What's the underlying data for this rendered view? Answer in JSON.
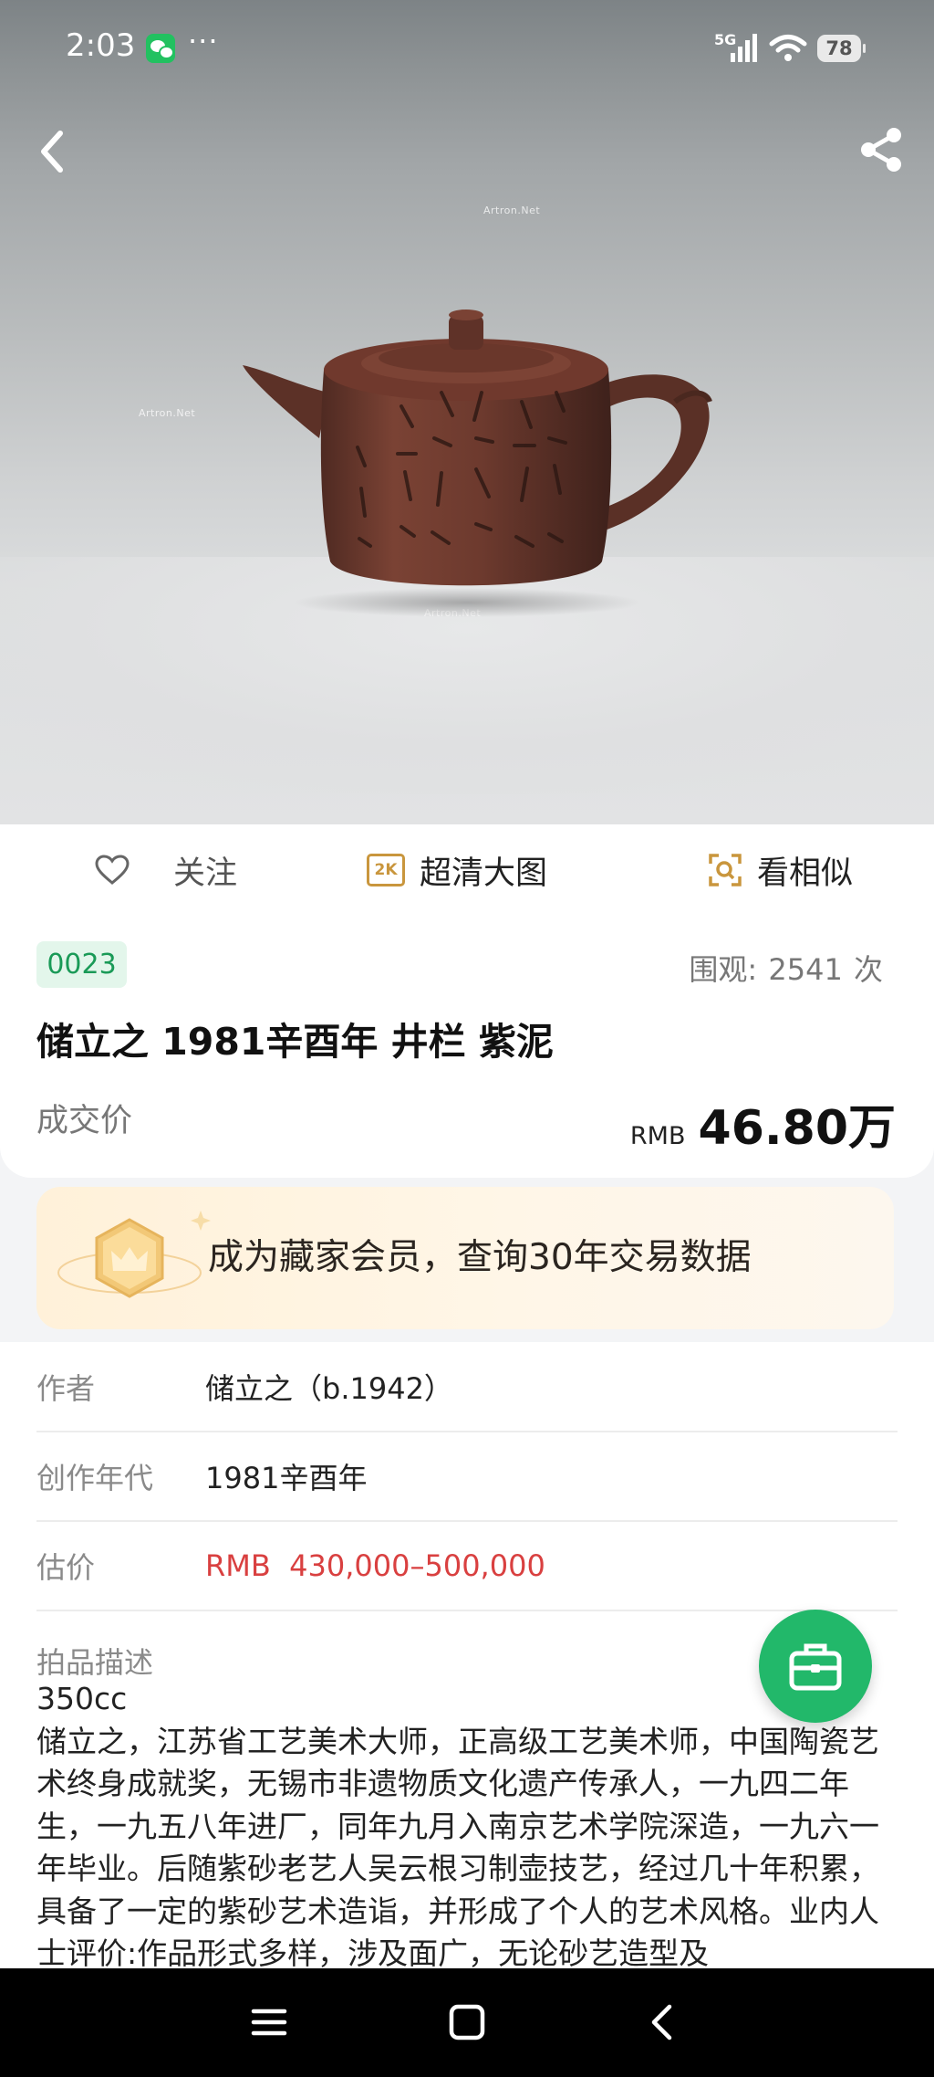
{
  "status_bar": {
    "time": "2:03",
    "more": "···",
    "network": "5G",
    "battery": "78"
  },
  "hero": {
    "watermark": "Artron.Net"
  },
  "actions": {
    "follow": "关注",
    "hd_badge": "2K",
    "hd_label": "超清大图",
    "similar": "看相似"
  },
  "lot": {
    "number": "0023",
    "views_label": "围观:",
    "views_count": "2541",
    "views_unit": "次",
    "title": "储立之 1981辛酉年 井栏 紫泥",
    "price_label": "成交价",
    "price_currency": "RMB",
    "price_value": "46.80万"
  },
  "member_banner": {
    "text": "成为藏家会员，查询30年交易数据"
  },
  "details": {
    "rows": [
      {
        "key": "作者",
        "value": "储立之（b.1942）"
      },
      {
        "key": "创作年代",
        "value": "1981辛酉年"
      },
      {
        "key": "估价",
        "value": "RMB  430,000–500,000"
      }
    ],
    "desc_label": "拍品描述",
    "desc_text": "350cc\n储立之，江苏省工艺美术大师，正高级工艺美术师，中国陶瓷艺术终身成就奖，无锡市非遗物质文化遗产传承人，一九四二年生，一九五八年进厂，同年九月入南京艺术学院深造，一九六一年毕业。后随紫砂老艺人吴云根习制壶技艺，经过几十年积累，具备了一定的紫砂艺术造诣，并形成了个人的艺术风格。业内人士评价:作品形式多样，涉及面广，无论砂艺造型及"
  },
  "colors": {
    "accent_green": "#22b86a",
    "estimate_red": "#d94040",
    "hd_gold": "#c9963d"
  }
}
